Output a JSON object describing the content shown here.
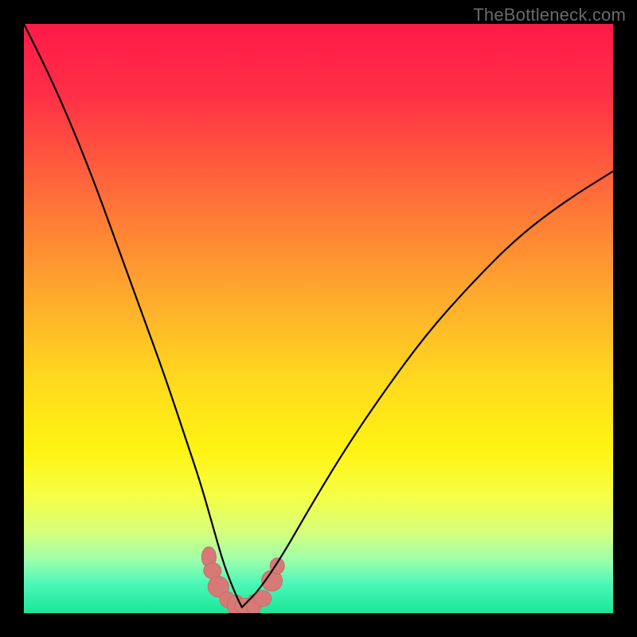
{
  "watermark": {
    "text": "TheBottleneck.com"
  },
  "colors": {
    "frame_bg": "#000000",
    "curve_stroke": "#000000",
    "blob_fill": "#d77a77",
    "blob_stroke": "#c96a67",
    "gradient_stops": [
      {
        "offset": 0.0,
        "color": "#ff1a49"
      },
      {
        "offset": 0.12,
        "color": "#ff2f46"
      },
      {
        "offset": 0.28,
        "color": "#ff6a3a"
      },
      {
        "offset": 0.45,
        "color": "#ffa62e"
      },
      {
        "offset": 0.6,
        "color": "#ffd81f"
      },
      {
        "offset": 0.72,
        "color": "#fff312"
      },
      {
        "offset": 0.8,
        "color": "#f6ff44"
      },
      {
        "offset": 0.86,
        "color": "#d8ff7a"
      },
      {
        "offset": 0.91,
        "color": "#9dffac"
      },
      {
        "offset": 0.95,
        "color": "#4cf7b8"
      },
      {
        "offset": 1.0,
        "color": "#19e698"
      }
    ]
  },
  "chart_data": {
    "type": "line",
    "title": "",
    "xlabel": "",
    "ylabel": "",
    "xlim": [
      0,
      100
    ],
    "ylim": [
      0,
      100
    ],
    "note": "Two curves plunging to a common minimum near x≈37; left branch starts near top-left, right branch ends near upper-right. Values are estimated from pixel positions; axes are unlabeled in source.",
    "series": [
      {
        "name": "left-branch",
        "x": [
          0,
          4,
          8,
          12,
          16,
          20,
          24,
          28,
          30,
          32,
          34,
          36,
          37
        ],
        "y": [
          100,
          92,
          83,
          73,
          62,
          51,
          40,
          28,
          22,
          15,
          8,
          3,
          1
        ]
      },
      {
        "name": "right-branch",
        "x": [
          37,
          40,
          44,
          48,
          54,
          60,
          68,
          76,
          84,
          92,
          100
        ],
        "y": [
          1,
          4,
          10,
          17,
          27,
          36,
          47,
          56,
          64,
          70,
          75
        ]
      }
    ],
    "markers": {
      "name": "valley-blobs",
      "points": [
        {
          "x": 31.4,
          "y": 9.5
        },
        {
          "x": 32.0,
          "y": 7.2
        },
        {
          "x": 33.0,
          "y": 4.5
        },
        {
          "x": 34.5,
          "y": 2.3
        },
        {
          "x": 36.0,
          "y": 1.3
        },
        {
          "x": 37.5,
          "y": 1.2
        },
        {
          "x": 39.0,
          "y": 1.4
        },
        {
          "x": 40.5,
          "y": 2.5
        },
        {
          "x": 42.1,
          "y": 5.5
        },
        {
          "x": 43.0,
          "y": 8.0
        }
      ]
    }
  }
}
